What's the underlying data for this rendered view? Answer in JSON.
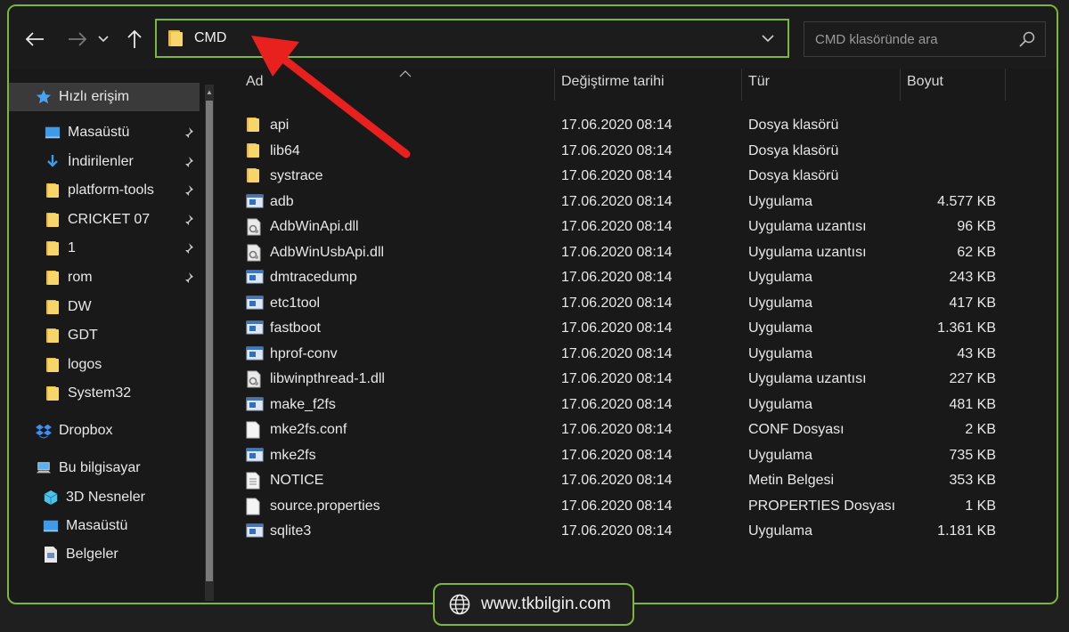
{
  "address": {
    "path": "CMD"
  },
  "search": {
    "placeholder": "CMD klasöründe ara"
  },
  "sidebar": {
    "quick_access": "Hızlı erişim",
    "items": [
      {
        "label": "Masaüstü",
        "icon": "desktop-icon",
        "pinned": true
      },
      {
        "label": "İndirilenler",
        "icon": "download-icon",
        "pinned": true
      },
      {
        "label": "platform-tools",
        "icon": "folder-icon",
        "pinned": true
      },
      {
        "label": "CRICKET 07",
        "icon": "folder-icon",
        "pinned": true
      },
      {
        "label": "1",
        "icon": "folder-icon",
        "pinned": true
      },
      {
        "label": "rom",
        "icon": "folder-icon",
        "pinned": true
      },
      {
        "label": "DW",
        "icon": "folder-icon",
        "pinned": false
      },
      {
        "label": "GDT",
        "icon": "folder-icon",
        "pinned": false
      },
      {
        "label": "logos",
        "icon": "folder-icon",
        "pinned": false
      },
      {
        "label": "System32",
        "icon": "folder-icon",
        "pinned": false
      }
    ],
    "dropbox": "Dropbox",
    "this_pc": "Bu bilgisayar",
    "pc_items": [
      {
        "label": "3D Nesneler",
        "icon": "cube-icon"
      },
      {
        "label": "Masaüstü",
        "icon": "desktop-icon"
      },
      {
        "label": "Belgeler",
        "icon": "document-icon"
      }
    ]
  },
  "columns": {
    "name": "Ad",
    "date": "Değiştirme tarihi",
    "type": "Tür",
    "size": "Boyut"
  },
  "files": [
    {
      "name": "api",
      "date": "17.06.2020 08:14",
      "type": "Dosya klasörü",
      "size": "",
      "icon": "folder"
    },
    {
      "name": "lib64",
      "date": "17.06.2020 08:14",
      "type": "Dosya klasörü",
      "size": "",
      "icon": "folder"
    },
    {
      "name": "systrace",
      "date": "17.06.2020 08:14",
      "type": "Dosya klasörü",
      "size": "",
      "icon": "folder"
    },
    {
      "name": "adb",
      "date": "17.06.2020 08:14",
      "type": "Uygulama",
      "size": "4.577 KB",
      "icon": "exe"
    },
    {
      "name": "AdbWinApi.dll",
      "date": "17.06.2020 08:14",
      "type": "Uygulama uzantısı",
      "size": "96 KB",
      "icon": "dll"
    },
    {
      "name": "AdbWinUsbApi.dll",
      "date": "17.06.2020 08:14",
      "type": "Uygulama uzantısı",
      "size": "62 KB",
      "icon": "dll"
    },
    {
      "name": "dmtracedump",
      "date": "17.06.2020 08:14",
      "type": "Uygulama",
      "size": "243 KB",
      "icon": "exe"
    },
    {
      "name": "etc1tool",
      "date": "17.06.2020 08:14",
      "type": "Uygulama",
      "size": "417 KB",
      "icon": "exe"
    },
    {
      "name": "fastboot",
      "date": "17.06.2020 08:14",
      "type": "Uygulama",
      "size": "1.361 KB",
      "icon": "exe"
    },
    {
      "name": "hprof-conv",
      "date": "17.06.2020 08:14",
      "type": "Uygulama",
      "size": "43 KB",
      "icon": "exe"
    },
    {
      "name": "libwinpthread-1.dll",
      "date": "17.06.2020 08:14",
      "type": "Uygulama uzantısı",
      "size": "227 KB",
      "icon": "dll"
    },
    {
      "name": "make_f2fs",
      "date": "17.06.2020 08:14",
      "type": "Uygulama",
      "size": "481 KB",
      "icon": "exe"
    },
    {
      "name": "mke2fs.conf",
      "date": "17.06.2020 08:14",
      "type": "CONF Dosyası",
      "size": "2 KB",
      "icon": "file"
    },
    {
      "name": "mke2fs",
      "date": "17.06.2020 08:14",
      "type": "Uygulama",
      "size": "735 KB",
      "icon": "exe"
    },
    {
      "name": "NOTICE",
      "date": "17.06.2020 08:14",
      "type": "Metin Belgesi",
      "size": "353 KB",
      "icon": "text"
    },
    {
      "name": "source.properties",
      "date": "17.06.2020 08:14",
      "type": "PROPERTIES Dosyası",
      "size": "1 KB",
      "icon": "file"
    },
    {
      "name": "sqlite3",
      "date": "17.06.2020 08:14",
      "type": "Uygulama",
      "size": "1.181 KB",
      "icon": "exe"
    }
  ],
  "watermark": {
    "text": "www.tkbilgin.com"
  },
  "colors": {
    "accent": "#7cb63c",
    "folder": "#f2c94c",
    "arrow": "#e8201e"
  }
}
